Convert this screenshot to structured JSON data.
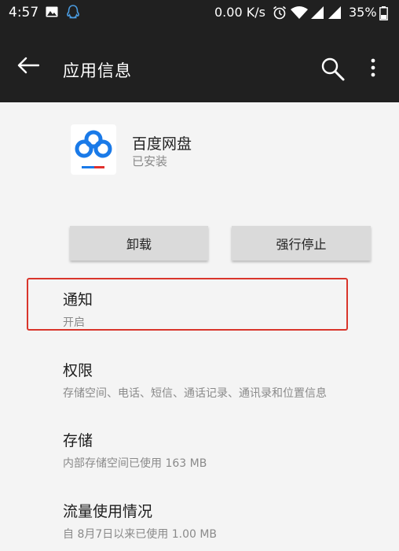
{
  "status_bar": {
    "time": "4:57",
    "network_speed": "0.00 K/s",
    "battery": "35%",
    "icons": [
      "image-icon",
      "qq-icon",
      "alarm-icon",
      "wifi-icon",
      "signal-icon",
      "signal-icon",
      "battery-icon"
    ]
  },
  "app_bar": {
    "title": "应用信息",
    "icons": [
      "back-arrow-icon",
      "search-icon",
      "more-vert-icon"
    ]
  },
  "app": {
    "name": "百度网盘",
    "status": "已安装",
    "icon": "baidu-netdisk-icon",
    "colors": {
      "blue": "#1a7ae8",
      "red": "#e0312e"
    }
  },
  "buttons": {
    "uninstall": "卸载",
    "force_stop": "强行停止"
  },
  "settings": [
    {
      "title": "通知",
      "subtitle": "开启"
    },
    {
      "title": "权限",
      "subtitle": "存储空间、电话、短信、通话记录、通讯录和位置信息"
    },
    {
      "title": "存储",
      "subtitle": "内部存储空间已使用 163 MB"
    },
    {
      "title": "流量使用情况",
      "subtitle": "自 8月7日以来已使用 1.00 MB"
    }
  ],
  "highlight_color": "#d9352b"
}
